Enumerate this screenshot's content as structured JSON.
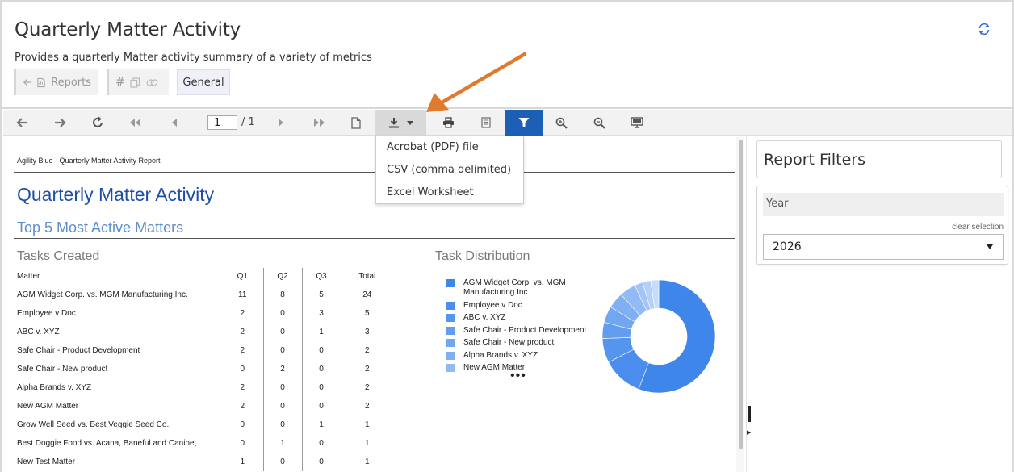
{
  "header": {
    "title": "Quarterly Matter Activity",
    "subtitle": "Provides a quarterly Matter activity summary of a variety of metrics",
    "reports_chip": "Reports",
    "general_chip": "General"
  },
  "toolbar": {
    "page_current": "1",
    "page_total": "/ 1"
  },
  "export_menu": [
    "Acrobat (PDF) file",
    "CSV (comma delimited)",
    "Excel Worksheet"
  ],
  "report": {
    "header": "Agility Blue - Quarterly Matter Activity Report",
    "title": "Quarterly Matter Activity",
    "subtitle": "Top 5 Most Active Matters",
    "tasks_title": "Tasks Created",
    "dist_title": "Task Distribution",
    "columns": [
      "Matter",
      "Q1",
      "Q2",
      "Q3",
      "Total"
    ],
    "rows": [
      [
        "AGM Widget Corp. vs. MGM Manufacturing Inc.",
        "11",
        "8",
        "5",
        "24"
      ],
      [
        "Employee v Doc",
        "2",
        "0",
        "3",
        "5"
      ],
      [
        "ABC v. XYZ",
        "2",
        "0",
        "1",
        "3"
      ],
      [
        "Safe Chair - Product Development",
        "2",
        "0",
        "0",
        "2"
      ],
      [
        "Safe Chair - New product",
        "0",
        "2",
        "0",
        "2"
      ],
      [
        "Alpha Brands v. XYZ",
        "2",
        "0",
        "0",
        "2"
      ],
      [
        "New AGM Matter",
        "2",
        "0",
        "0",
        "2"
      ],
      [
        "Grow Well Seed vs. Best Veggie Seed Co.",
        "0",
        "0",
        "1",
        "1"
      ],
      [
        "Best Doggie Food vs. Acana, Baneful and Canine,",
        "0",
        "1",
        "0",
        "1"
      ],
      [
        "New Test Matter",
        "1",
        "0",
        "0",
        "1"
      ]
    ],
    "legend": [
      {
        "label": "AGM Widget Corp. vs. MGM Manufacturing Inc.",
        "color": "#3f86ea"
      },
      {
        "label": "Employee v Doc",
        "color": "#4a8ded"
      },
      {
        "label": "ABC v. XYZ",
        "color": "#5595ee"
      },
      {
        "label": "Safe Chair - Product Development",
        "color": "#629def"
      },
      {
        "label": "Safe Chair - New product",
        "color": "#71a6f0"
      },
      {
        "label": "Alpha Brands v. XYZ",
        "color": "#80aff2"
      },
      {
        "label": "New AGM Matter",
        "color": "#92baf4"
      }
    ],
    "more_indicator": "•••"
  },
  "chart_data": {
    "type": "pie",
    "title": "Task Distribution",
    "categories": [
      "AGM Widget Corp. vs. MGM Manufacturing Inc.",
      "Employee v Doc",
      "ABC v. XYZ",
      "Safe Chair - Product Development",
      "Safe Chair - New product",
      "Alpha Brands v. XYZ",
      "New AGM Matter",
      "Grow Well Seed vs. Best Veggie Seed Co.",
      "Best Doggie Food vs. Acana, Baneful and Canine,",
      "New Test Matter"
    ],
    "values": [
      24,
      5,
      3,
      2,
      2,
      2,
      2,
      1,
      1,
      1
    ],
    "colors": [
      "#3f86ea",
      "#4a8ded",
      "#5595ee",
      "#629def",
      "#71a6f0",
      "#80aff2",
      "#92baf4",
      "#a3c5f6",
      "#b5d0f8",
      "#c7dcfa"
    ],
    "donut": true,
    "legend_position": "left"
  },
  "filters": {
    "title": "Report Filters",
    "year_label": "Year",
    "clear_label": "clear selection",
    "year_value": "2026"
  },
  "colors": {
    "accent": "#1c5fb4",
    "report_title": "#1f4fa4",
    "arrow": "#e07b2e"
  }
}
